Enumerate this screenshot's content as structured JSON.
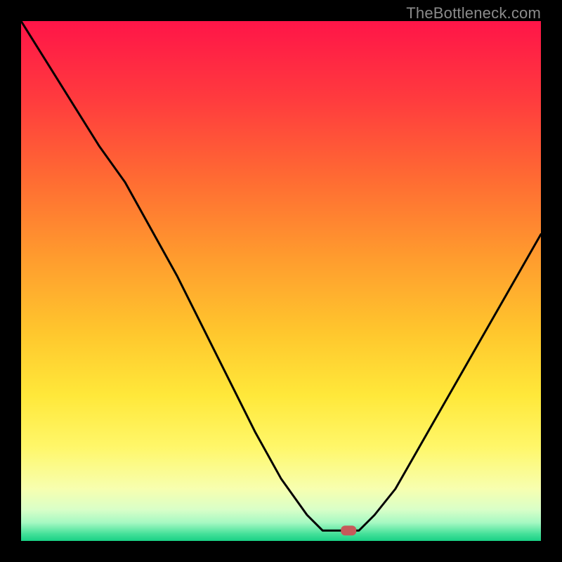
{
  "attribution": "TheBottleneck.com",
  "chart_data": {
    "type": "line",
    "title": "",
    "xlabel": "",
    "ylabel": "",
    "xlim": [
      0,
      1
    ],
    "ylim": [
      0,
      1
    ],
    "grid": false,
    "legend": false,
    "marker": {
      "x": 0.63,
      "y": 0.98,
      "color": "#c65a5a"
    },
    "curve": [
      {
        "x": 0.0,
        "y": 0.0
      },
      {
        "x": 0.05,
        "y": 0.08
      },
      {
        "x": 0.1,
        "y": 0.16
      },
      {
        "x": 0.15,
        "y": 0.24
      },
      {
        "x": 0.2,
        "y": 0.31
      },
      {
        "x": 0.25,
        "y": 0.4
      },
      {
        "x": 0.3,
        "y": 0.49
      },
      {
        "x": 0.35,
        "y": 0.59
      },
      {
        "x": 0.4,
        "y": 0.69
      },
      {
        "x": 0.45,
        "y": 0.79
      },
      {
        "x": 0.5,
        "y": 0.88
      },
      {
        "x": 0.55,
        "y": 0.95
      },
      {
        "x": 0.58,
        "y": 0.98
      },
      {
        "x": 0.62,
        "y": 0.98
      },
      {
        "x": 0.65,
        "y": 0.98
      },
      {
        "x": 0.68,
        "y": 0.95
      },
      {
        "x": 0.72,
        "y": 0.9
      },
      {
        "x": 0.76,
        "y": 0.83
      },
      {
        "x": 0.8,
        "y": 0.76
      },
      {
        "x": 0.84,
        "y": 0.69
      },
      {
        "x": 0.88,
        "y": 0.62
      },
      {
        "x": 0.92,
        "y": 0.55
      },
      {
        "x": 0.96,
        "y": 0.48
      },
      {
        "x": 1.0,
        "y": 0.41
      }
    ],
    "bands": [
      {
        "y0": 0.0,
        "y1": 0.15,
        "c0": "#ff1548",
        "c1": "#ff3b3e"
      },
      {
        "y0": 0.15,
        "y1": 0.3,
        "c0": "#ff3b3e",
        "c1": "#ff6a33"
      },
      {
        "y0": 0.3,
        "y1": 0.45,
        "c0": "#ff6a33",
        "c1": "#ff9a2e"
      },
      {
        "y0": 0.45,
        "y1": 0.6,
        "c0": "#ff9a2e",
        "c1": "#ffc72d"
      },
      {
        "y0": 0.6,
        "y1": 0.72,
        "c0": "#ffc72d",
        "c1": "#ffe83a"
      },
      {
        "y0": 0.72,
        "y1": 0.82,
        "c0": "#ffe83a",
        "c1": "#fff76a"
      },
      {
        "y0": 0.82,
        "y1": 0.9,
        "c0": "#fff76a",
        "c1": "#f7ffb0"
      },
      {
        "y0": 0.9,
        "y1": 0.94,
        "c0": "#f7ffb0",
        "c1": "#d8ffc8"
      },
      {
        "y0": 0.94,
        "y1": 0.965,
        "c0": "#d8ffc8",
        "c1": "#a4f8c2"
      },
      {
        "y0": 0.965,
        "y1": 0.985,
        "c0": "#a4f8c2",
        "c1": "#49e29b"
      },
      {
        "y0": 0.985,
        "y1": 1.0,
        "c0": "#49e29b",
        "c1": "#17d084"
      }
    ]
  }
}
